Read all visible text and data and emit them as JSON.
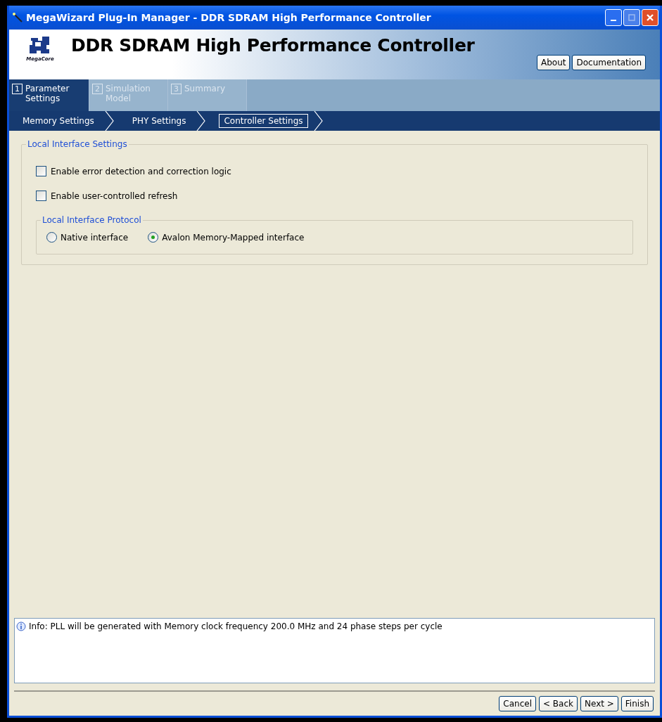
{
  "window": {
    "title": "MegaWizard Plug-In Manager - DDR SDRAM High Performance Controller"
  },
  "header": {
    "title": "DDR SDRAM High Performance Controller",
    "logo_caption": "MegaCore",
    "buttons": [
      "About",
      "Documentation"
    ]
  },
  "steps": [
    {
      "number": "1",
      "label": "Parameter Settings",
      "selected": true
    },
    {
      "number": "2",
      "label": "Simulation Model",
      "selected": false
    },
    {
      "number": "3",
      "label": "Summary",
      "selected": false
    }
  ],
  "breadcrumbs": [
    {
      "label": "Memory Settings",
      "selected": false
    },
    {
      "label": "PHY Settings",
      "selected": false
    },
    {
      "label": "Controller Settings",
      "selected": true
    }
  ],
  "group": {
    "title": "Local Interface Settings",
    "checkboxes": [
      {
        "label": "Enable error detection and correction logic",
        "checked": false
      },
      {
        "label": "Enable user-controlled refresh",
        "checked": false
      }
    ],
    "protocol": {
      "title": "Local Interface Protocol",
      "options": [
        {
          "label": "Native interface",
          "selected": false
        },
        {
          "label": "Avalon Memory-Mapped interface",
          "selected": true
        }
      ]
    }
  },
  "messages": [
    {
      "kind": "info",
      "text": "Info: PLL will be generated with Memory clock frequency 200.0 MHz and 24 phase steps per cycle"
    }
  ],
  "footer_buttons": [
    "Cancel",
    "< Back",
    "Next >",
    "Finish"
  ]
}
